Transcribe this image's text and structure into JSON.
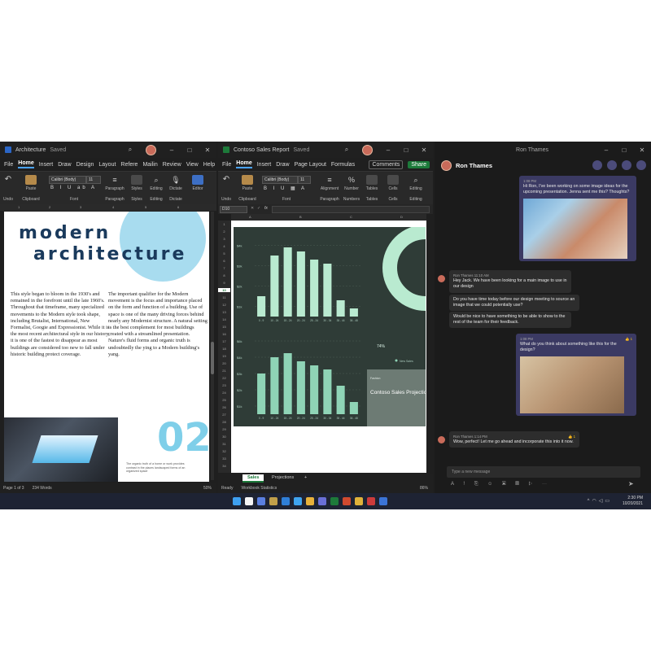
{
  "word": {
    "title": "Architecture",
    "saved": "Saved",
    "menu": [
      "File",
      "Home",
      "Insert",
      "Draw",
      "Design",
      "Layout",
      "Refere",
      "Mailin",
      "Review",
      "View",
      "Help"
    ],
    "font_name": "Calibri (Body)",
    "font_size": "11",
    "ribbon_groups": [
      "Undo",
      "Clipboard",
      "Font",
      "Paragraph",
      "Styles",
      "Editing",
      "Dictate",
      "Editor"
    ],
    "ribbon_buttons": {
      "paste": "Paste",
      "paragraph": "Paragraph",
      "styles": "Styles",
      "editing": "Editing",
      "dictate": "Dictate"
    },
    "ruler": [
      "1",
      "2",
      "3",
      "4",
      "5",
      "6"
    ],
    "heading1": "modern",
    "heading2": "architecture",
    "col1": "This style began to bloom in the 1930's and remained in the forefront until the late 1960's. Throughout that timeframe, many specialized movements to the Modern style took shape, including Brutalist, International, New Formalist, Googie and Expressionist. While it is the most recent architectural style in our history, it is one of the fastest to disappear as most buildings are considered too new to fall under historic building protect coverage.",
    "col2": "The important qualifier for the Modern movement is the focus and importance placed on the form and function of a building. Use of space is one of the many driving forces behind nearly any Modernist structure. A natural setting is the best complement for most buildings created with a streamlined presentation. Nature's fluid forms and organic truth is undoubtedly the ying to a Modern building's yang.",
    "big_number": "02",
    "caption": "The organic truth of a home or work provides contrast in the places landscaped forms of an organized space",
    "status": {
      "page": "Page 1 of 3",
      "words": "234 Words",
      "zoom": "50%"
    }
  },
  "excel": {
    "title": "Contoso Sales Report",
    "saved": "Saved",
    "menu": [
      "File",
      "Home",
      "Insert",
      "Draw",
      "Page Layout",
      "Formulas"
    ],
    "comments": "Comments",
    "share": "Share",
    "font_name": "Calibri (Body)",
    "font_size": "11",
    "ribbon_groups": [
      "Undo",
      "Clipboard",
      "Font",
      "Paragraph",
      "Numbers",
      "Tables",
      "Cells",
      "Editing"
    ],
    "ribbon_buttons": {
      "paste": "Paste",
      "alignment": "Alignment",
      "number": "Number",
      "tables": "Tables",
      "cells": "Cells",
      "editing": "Editing"
    },
    "namebox": "D10",
    "fx": "fx",
    "columns": [
      "A",
      "B",
      "C",
      "D"
    ],
    "rows": [
      "1",
      "2",
      "3",
      "4",
      "5",
      "6",
      "7",
      "8",
      "9",
      "10",
      "11",
      "12",
      "13",
      "14",
      "15",
      "16",
      "17",
      "18",
      "19",
      "20",
      "21",
      "22",
      "23",
      "24",
      "25",
      "26",
      "27",
      "28",
      "29",
      "30",
      "31",
      "32",
      "33",
      "34"
    ],
    "active_row": "10",
    "sheets": [
      "Sales",
      "Projections"
    ],
    "add_sheet": "+",
    "status": {
      "ready": "Ready",
      "stats": "Workbook Statistics",
      "zoom": "86%"
    },
    "dashboard_title": "Contoso Sales Projections",
    "dashboard_subtitle": "Fashion",
    "donut_label": "74%",
    "legend": "New Sales",
    "chart_colors": {
      "bg": "#2f3c37",
      "bar": "#8fd4b6",
      "bar_light": "#b9ead0",
      "panel": "#6d7b74"
    }
  },
  "chart_data": [
    {
      "type": "bar",
      "categories": [
        "0 - 9",
        "10 - 24",
        "15 - 24",
        "20 - 24",
        "25 - 24",
        "30 - 34",
        "35 - 44",
        "36 - 48"
      ],
      "values": [
        100,
        300,
        340,
        320,
        280,
        260,
        80,
        40
      ],
      "ylabels": [
        "$4k",
        "$3k",
        "$2k",
        "$1k"
      ]
    },
    {
      "type": "bar",
      "categories": [
        "0 - 9",
        "10 - 24",
        "15 - 24",
        "20 - 24",
        "25 - 24",
        "30 - 34",
        "35 - 44",
        "36 - 48"
      ],
      "values": [
        200,
        280,
        300,
        260,
        240,
        220,
        140,
        60
      ],
      "ylabels": [
        "$6k",
        "$4k",
        "$3k",
        "$2k",
        "$1k"
      ]
    }
  ],
  "teams": {
    "window_title": "Ron Thames",
    "contact": "Ron Thames",
    "messages": [
      {
        "who": "me",
        "time": "1:08 PM",
        "text": "Hi Ron, I've been working on some image ideas for the upcoming presentation. Jenna sent me this? Thoughts?"
      },
      {
        "who": "them",
        "name": "Ron Thames",
        "time": "11:10 AM",
        "text": "Hey Jack. We have been looking for a main image to use in our design"
      },
      {
        "who": "them",
        "text": "Do you have time today before our design meeting to source an image that we could potentially use?"
      },
      {
        "who": "them",
        "text": "Would be nice to have something to be able to show to the rest of the team for their feedback."
      },
      {
        "who": "me",
        "time": "1:08 PM",
        "text": "What do you think about something like this for the design?",
        "reaction": "👍 1"
      },
      {
        "who": "them",
        "name": "Ron Thames",
        "time": "1:14 PM",
        "text": "Wow, perfect! Let me go ahead and incorporate this into it now.",
        "reaction": "👍 1"
      }
    ],
    "compose_placeholder": "Type a new message"
  },
  "taskbar": {
    "time": "2:30 PM",
    "date": "10/20/2021",
    "icon_colors": [
      "#3ea0f0",
      "#f5f5f5",
      "#5a7fe0",
      "#c09f4a",
      "#2f7fd8",
      "#3fa4f0",
      "#e8b13a",
      "#6a6fd6",
      "#1d7a3a",
      "#d04a2f",
      "#e0b23a",
      "#cc3b3b",
      "#3b74d6"
    ]
  }
}
